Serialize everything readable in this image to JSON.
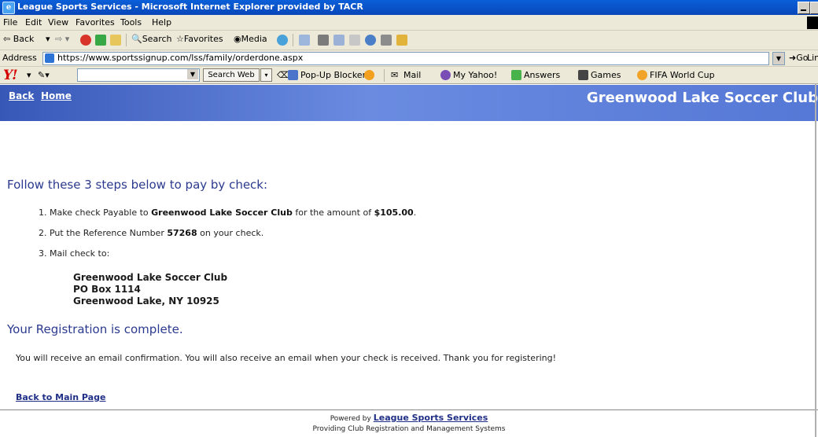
{
  "window": {
    "title": "League Sports Services - Microsoft Internet Explorer provided by TACR"
  },
  "menu": [
    "File",
    "Edit",
    "View",
    "Favorites",
    "Tools",
    "Help"
  ],
  "toolbar": {
    "back": "Back",
    "search": "Search",
    "favorites": "Favorites",
    "media": "Media"
  },
  "address": {
    "label": "Address",
    "url": "https://www.sportssignup.com/lss/family/orderdone.aspx",
    "go": "Go",
    "links": "Lin"
  },
  "yahoo": {
    "search_button": "Search Web",
    "popup_blocker": "Pop-Up Blocker",
    "mail": "Mail",
    "my_yahoo": "My Yahoo!",
    "answers": "Answers",
    "games": "Games",
    "fifa": "FIFA World Cup"
  },
  "banner": {
    "back": "Back",
    "home": "Home",
    "club": "Greenwood Lake Soccer Club"
  },
  "steps": {
    "heading": "Follow these 3 steps below to pay by check:",
    "s1_pre": "1. Make check Payable to ",
    "s1_club": "Greenwood Lake Soccer Club",
    "s1_mid": " for the amount of  ",
    "s1_amount": "$105.00",
    "s1_end": ".",
    "s2_pre": "2. Put the Reference Number ",
    "s2_ref": "57268",
    "s2_end": " on your check.",
    "s3": "3. Mail check to:"
  },
  "mail_address": {
    "line1": "Greenwood Lake Soccer Club",
    "line2": "PO Box 1114",
    "line3": "Greenwood Lake, NY 10925"
  },
  "done": {
    "heading": "Your Registration is complete.",
    "message": "You will receive an email confirmation.  You will also receive an email when your check is received.  Thank you for registering!",
    "main_link": "Back to Main Page"
  },
  "footer": {
    "powered_by": "Powered by ",
    "lss_link": "League Sports Services",
    "providing": "Providing Club Registration and Management Systems"
  }
}
